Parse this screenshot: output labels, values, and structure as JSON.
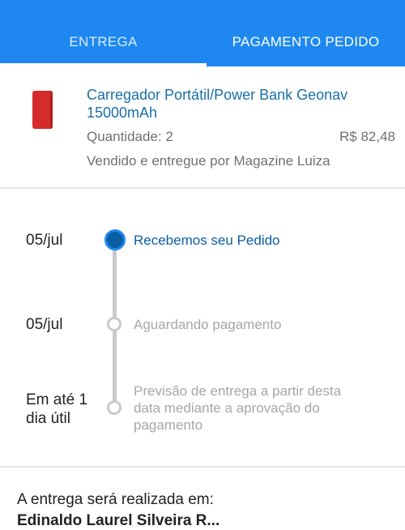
{
  "tabs": [
    {
      "label": "ENTREGA",
      "active": true
    },
    {
      "label": "PAGAMENTO PEDIDO",
      "active": false
    }
  ],
  "product": {
    "name": "Carregador Portátil/Power Bank Geonav 15000mAh",
    "quantity_label": "Quantidade: 2",
    "price": "R$ 82,48",
    "seller": "Vendido e entregue por Magazine Luiza",
    "image_color": "#d52b2b"
  },
  "timeline": [
    {
      "date": "05/jul",
      "label": "Recebemos seu Pedido",
      "status": "done"
    },
    {
      "date": "05/jul",
      "label": "Aguardando pagamento",
      "status": "pending"
    },
    {
      "date": "Em até 1 dia útil",
      "label": "Previsão de entrega a partir desta data mediante a aprovação do pagamento",
      "status": "pending"
    }
  ],
  "delivery": {
    "title": "A entrega será realizada em:",
    "address_partial": "Edinaldo Laurel Silveira R..."
  },
  "colors": {
    "brand_blue": "#1e88f0",
    "link_blue": "#1b6fa8",
    "active_dot": "#0b5ea3",
    "inactive_gray": "#c9c9c9"
  }
}
